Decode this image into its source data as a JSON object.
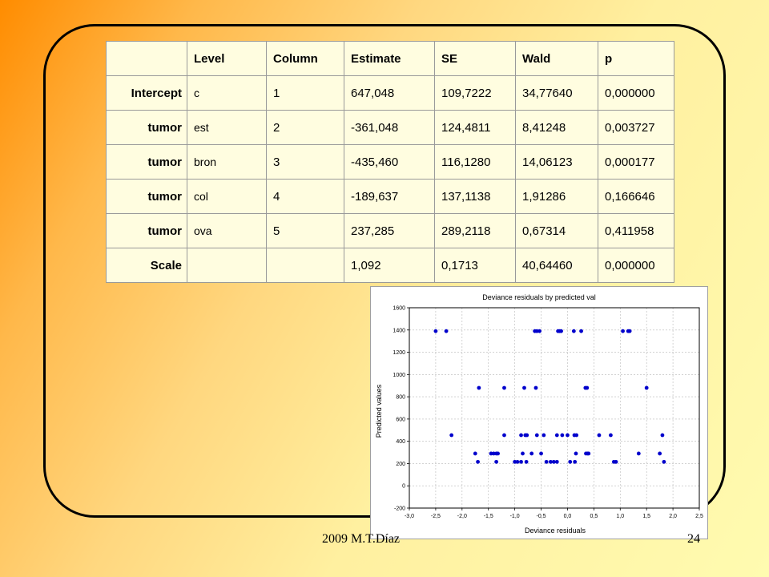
{
  "table": {
    "headers": [
      "",
      "Level",
      "Column",
      "Estimate",
      "SE",
      "Wald",
      "p"
    ],
    "rows": [
      {
        "effect": "Intercept",
        "level": "c",
        "column": "1",
        "estimate": "647,048",
        "se": "109,7222",
        "wald": "34,77640",
        "p": "0,000000"
      },
      {
        "effect": "tumor",
        "level": "est",
        "column": "2",
        "estimate": "-361,048",
        "se": "124,4811",
        "wald": "8,41248",
        "p": "0,003727"
      },
      {
        "effect": "tumor",
        "level": "bron",
        "column": "3",
        "estimate": "-435,460",
        "se": "116,1280",
        "wald": "14,06123",
        "p": "0,000177"
      },
      {
        "effect": "tumor",
        "level": "col",
        "column": "4",
        "estimate": "-189,637",
        "se": "137,1138",
        "wald": "1,91286",
        "p": "0,166646"
      },
      {
        "effect": "tumor",
        "level": "ova",
        "column": "5",
        "estimate": "237,285",
        "se": "289,2118",
        "wald": "0,67314",
        "p": "0,411958"
      },
      {
        "effect": "Scale",
        "level": "",
        "column": "",
        "estimate": "1,092",
        "se": "0,1713",
        "wald": "40,64460",
        "p": "0,000000"
      }
    ]
  },
  "chart_data": {
    "type": "scatter",
    "title": "Deviance residuals by predicted val",
    "xlabel": "Deviance residuals",
    "ylabel": "Predicted values",
    "xlim": [
      -3.0,
      2.5
    ],
    "ylim": [
      -200,
      1600
    ],
    "xticks": [
      "-3,0",
      "-2,5",
      "-2,0",
      "-1,5",
      "-1,0",
      "-0,5",
      "0,0",
      "0,5",
      "1,0",
      "1,5",
      "2,0",
      "2,5"
    ],
    "yticks": [
      "-200",
      "0",
      "200",
      "400",
      "600",
      "800",
      "1000",
      "1200",
      "1400",
      "1600"
    ],
    "grid": true,
    "point_color": "#0000cc",
    "points": [
      [
        -2.5,
        1390
      ],
      [
        -2.3,
        1390
      ],
      [
        -0.62,
        1390
      ],
      [
        -0.58,
        1390
      ],
      [
        -0.53,
        1390
      ],
      [
        -0.18,
        1390
      ],
      [
        -0.15,
        1390
      ],
      [
        -0.12,
        1390
      ],
      [
        0.12,
        1390
      ],
      [
        0.26,
        1390
      ],
      [
        1.05,
        1390
      ],
      [
        1.15,
        1390
      ],
      [
        1.18,
        1390
      ],
      [
        -1.68,
        880
      ],
      [
        -1.2,
        880
      ],
      [
        -0.82,
        880
      ],
      [
        -0.6,
        880
      ],
      [
        0.34,
        880
      ],
      [
        0.37,
        880
      ],
      [
        1.5,
        880
      ],
      [
        -2.2,
        455
      ],
      [
        -1.2,
        455
      ],
      [
        -0.88,
        455
      ],
      [
        -0.8,
        455
      ],
      [
        -0.77,
        455
      ],
      [
        -0.58,
        455
      ],
      [
        -0.45,
        455
      ],
      [
        -0.2,
        455
      ],
      [
        -0.1,
        455
      ],
      [
        0.0,
        455
      ],
      [
        0.13,
        455
      ],
      [
        0.17,
        455
      ],
      [
        0.6,
        455
      ],
      [
        0.82,
        455
      ],
      [
        1.8,
        455
      ],
      [
        -1.75,
        290
      ],
      [
        -1.45,
        290
      ],
      [
        -1.4,
        290
      ],
      [
        -1.35,
        290
      ],
      [
        -1.32,
        290
      ],
      [
        -0.85,
        290
      ],
      [
        -0.68,
        290
      ],
      [
        -0.5,
        290
      ],
      [
        0.16,
        290
      ],
      [
        0.35,
        290
      ],
      [
        0.38,
        290
      ],
      [
        0.4,
        290
      ],
      [
        1.35,
        290
      ],
      [
        1.75,
        290
      ],
      [
        -1.7,
        215
      ],
      [
        -1.35,
        215
      ],
      [
        -1.0,
        215
      ],
      [
        -0.95,
        215
      ],
      [
        -0.88,
        215
      ],
      [
        -0.78,
        215
      ],
      [
        -0.4,
        215
      ],
      [
        -0.32,
        215
      ],
      [
        -0.26,
        215
      ],
      [
        -0.2,
        215
      ],
      [
        0.05,
        215
      ],
      [
        0.14,
        215
      ],
      [
        0.88,
        215
      ],
      [
        0.92,
        215
      ],
      [
        1.83,
        215
      ]
    ]
  },
  "footer": {
    "left": "2009  M.T.Díaz",
    "right": "24"
  }
}
